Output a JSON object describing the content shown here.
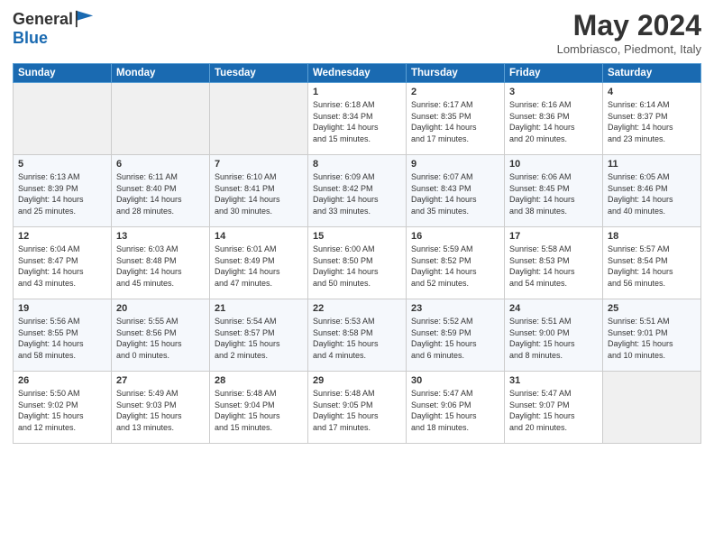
{
  "logo": {
    "general": "General",
    "blue": "Blue"
  },
  "title": "May 2024",
  "location": "Lombriasco, Piedmont, Italy",
  "days_header": [
    "Sunday",
    "Monday",
    "Tuesday",
    "Wednesday",
    "Thursday",
    "Friday",
    "Saturday"
  ],
  "weeks": [
    [
      {
        "day": "",
        "info": ""
      },
      {
        "day": "",
        "info": ""
      },
      {
        "day": "",
        "info": ""
      },
      {
        "day": "1",
        "info": "Sunrise: 6:18 AM\nSunset: 8:34 PM\nDaylight: 14 hours\nand 15 minutes."
      },
      {
        "day": "2",
        "info": "Sunrise: 6:17 AM\nSunset: 8:35 PM\nDaylight: 14 hours\nand 17 minutes."
      },
      {
        "day": "3",
        "info": "Sunrise: 6:16 AM\nSunset: 8:36 PM\nDaylight: 14 hours\nand 20 minutes."
      },
      {
        "day": "4",
        "info": "Sunrise: 6:14 AM\nSunset: 8:37 PM\nDaylight: 14 hours\nand 23 minutes."
      }
    ],
    [
      {
        "day": "5",
        "info": "Sunrise: 6:13 AM\nSunset: 8:39 PM\nDaylight: 14 hours\nand 25 minutes."
      },
      {
        "day": "6",
        "info": "Sunrise: 6:11 AM\nSunset: 8:40 PM\nDaylight: 14 hours\nand 28 minutes."
      },
      {
        "day": "7",
        "info": "Sunrise: 6:10 AM\nSunset: 8:41 PM\nDaylight: 14 hours\nand 30 minutes."
      },
      {
        "day": "8",
        "info": "Sunrise: 6:09 AM\nSunset: 8:42 PM\nDaylight: 14 hours\nand 33 minutes."
      },
      {
        "day": "9",
        "info": "Sunrise: 6:07 AM\nSunset: 8:43 PM\nDaylight: 14 hours\nand 35 minutes."
      },
      {
        "day": "10",
        "info": "Sunrise: 6:06 AM\nSunset: 8:45 PM\nDaylight: 14 hours\nand 38 minutes."
      },
      {
        "day": "11",
        "info": "Sunrise: 6:05 AM\nSunset: 8:46 PM\nDaylight: 14 hours\nand 40 minutes."
      }
    ],
    [
      {
        "day": "12",
        "info": "Sunrise: 6:04 AM\nSunset: 8:47 PM\nDaylight: 14 hours\nand 43 minutes."
      },
      {
        "day": "13",
        "info": "Sunrise: 6:03 AM\nSunset: 8:48 PM\nDaylight: 14 hours\nand 45 minutes."
      },
      {
        "day": "14",
        "info": "Sunrise: 6:01 AM\nSunset: 8:49 PM\nDaylight: 14 hours\nand 47 minutes."
      },
      {
        "day": "15",
        "info": "Sunrise: 6:00 AM\nSunset: 8:50 PM\nDaylight: 14 hours\nand 50 minutes."
      },
      {
        "day": "16",
        "info": "Sunrise: 5:59 AM\nSunset: 8:52 PM\nDaylight: 14 hours\nand 52 minutes."
      },
      {
        "day": "17",
        "info": "Sunrise: 5:58 AM\nSunset: 8:53 PM\nDaylight: 14 hours\nand 54 minutes."
      },
      {
        "day": "18",
        "info": "Sunrise: 5:57 AM\nSunset: 8:54 PM\nDaylight: 14 hours\nand 56 minutes."
      }
    ],
    [
      {
        "day": "19",
        "info": "Sunrise: 5:56 AM\nSunset: 8:55 PM\nDaylight: 14 hours\nand 58 minutes."
      },
      {
        "day": "20",
        "info": "Sunrise: 5:55 AM\nSunset: 8:56 PM\nDaylight: 15 hours\nand 0 minutes."
      },
      {
        "day": "21",
        "info": "Sunrise: 5:54 AM\nSunset: 8:57 PM\nDaylight: 15 hours\nand 2 minutes."
      },
      {
        "day": "22",
        "info": "Sunrise: 5:53 AM\nSunset: 8:58 PM\nDaylight: 15 hours\nand 4 minutes."
      },
      {
        "day": "23",
        "info": "Sunrise: 5:52 AM\nSunset: 8:59 PM\nDaylight: 15 hours\nand 6 minutes."
      },
      {
        "day": "24",
        "info": "Sunrise: 5:51 AM\nSunset: 9:00 PM\nDaylight: 15 hours\nand 8 minutes."
      },
      {
        "day": "25",
        "info": "Sunrise: 5:51 AM\nSunset: 9:01 PM\nDaylight: 15 hours\nand 10 minutes."
      }
    ],
    [
      {
        "day": "26",
        "info": "Sunrise: 5:50 AM\nSunset: 9:02 PM\nDaylight: 15 hours\nand 12 minutes."
      },
      {
        "day": "27",
        "info": "Sunrise: 5:49 AM\nSunset: 9:03 PM\nDaylight: 15 hours\nand 13 minutes."
      },
      {
        "day": "28",
        "info": "Sunrise: 5:48 AM\nSunset: 9:04 PM\nDaylight: 15 hours\nand 15 minutes."
      },
      {
        "day": "29",
        "info": "Sunrise: 5:48 AM\nSunset: 9:05 PM\nDaylight: 15 hours\nand 17 minutes."
      },
      {
        "day": "30",
        "info": "Sunrise: 5:47 AM\nSunset: 9:06 PM\nDaylight: 15 hours\nand 18 minutes."
      },
      {
        "day": "31",
        "info": "Sunrise: 5:47 AM\nSunset: 9:07 PM\nDaylight: 15 hours\nand 20 minutes."
      },
      {
        "day": "",
        "info": ""
      }
    ]
  ]
}
